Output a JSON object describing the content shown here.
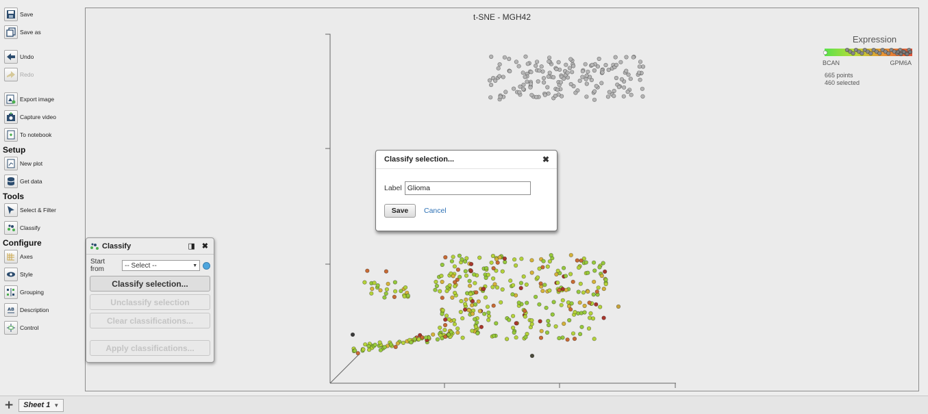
{
  "sidebar": {
    "save": "Save",
    "save_as": "Save as",
    "undo": "Undo",
    "redo": "Redo",
    "export_image": "Export image",
    "capture_video": "Capture video",
    "to_notebook": "To notebook",
    "setup_heading": "Setup",
    "new_plot": "New plot",
    "get_data": "Get data",
    "tools_heading": "Tools",
    "select_filter": "Select & Filter",
    "classify": "Classify",
    "configure_heading": "Configure",
    "axes": "Axes",
    "style": "Style",
    "grouping": "Grouping",
    "description": "Description",
    "control": "Control"
  },
  "plot": {
    "title": "t-SNE - MGH42",
    "legend": {
      "title": "Expression",
      "low_label": "BCAN",
      "high_label": "GPM6A",
      "points": "665 points",
      "selected": "460 selected",
      "gradient_colors": [
        "#59e14b",
        "#b9dc39",
        "#e79433",
        "#e0543b"
      ]
    }
  },
  "modal": {
    "title": "Classify selection...",
    "label_text": "Label",
    "label_value": "Glioma",
    "save": "Save",
    "cancel": "Cancel"
  },
  "classify_panel": {
    "title": "Classify",
    "start_from_label": "Start from",
    "select_value": "-- Select --",
    "classify_selection": "Classify selection...",
    "unclassify_selection": "Unclassify selection",
    "clear_classifications": "Clear classifications...",
    "apply_classifications": "Apply classifications..."
  },
  "bottom": {
    "sheet_tab": "Sheet 1"
  },
  "colors": {
    "gray_points": "#b5b5b5",
    "link": "#2a6fb4",
    "status_dot": "#4ea5dd"
  }
}
